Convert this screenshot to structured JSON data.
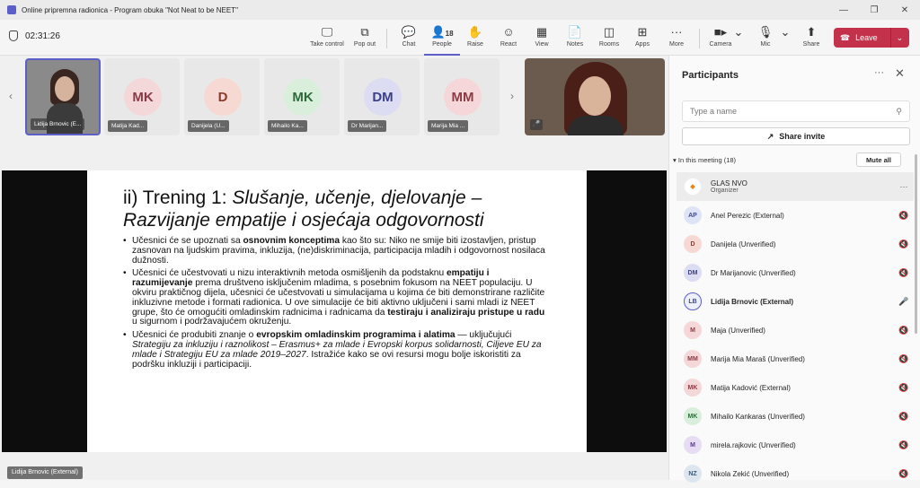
{
  "window": {
    "title": "Online pripremna radionica - Program obuka \"Not Neat to be NEET\"",
    "minimize": "—",
    "restore": "❐",
    "close": "✕"
  },
  "toolbar": {
    "timer": "02:31:26",
    "take_control": "Take control",
    "pop_out": "Pop out",
    "chat": "Chat",
    "people": "People",
    "people_count": "18",
    "raise": "Raise",
    "react": "React",
    "view": "View",
    "notes": "Notes",
    "rooms": "Rooms",
    "apps": "Apps",
    "more": "More",
    "camera": "Camera",
    "mic": "Mic",
    "share": "Share",
    "leave": "Leave"
  },
  "gallery": {
    "tiles": [
      {
        "initials": "",
        "name": "Lidija Brnovic (E..."
      },
      {
        "initials": "MK",
        "name": "Matija Kad...",
        "bg": "#f4d7d9",
        "fg": "#8a3b44"
      },
      {
        "initials": "D",
        "name": "Danijela (U...",
        "bg": "#f6d9d3",
        "fg": "#8a3b2f"
      },
      {
        "initials": "MK",
        "name": "Mihailo Ka...",
        "bg": "#d9efdc",
        "fg": "#2e6b39"
      },
      {
        "initials": "DM",
        "name": "Dr Marijan...",
        "bg": "#dcdcf3",
        "fg": "#3b3f8a"
      },
      {
        "initials": "MM",
        "name": "Marija Mia ...",
        "bg": "#f6d7d9",
        "fg": "#8a3b44"
      }
    ]
  },
  "slide": {
    "title_plain": "ii) Trening 1: ",
    "title_italic1": "Slušanje, učenje, djelovanje –",
    "title_italic2": "Razvijanje empatije i osjećaja odgovornosti",
    "b1_a": "Učesnici će se upoznati sa ",
    "b1_b": "osnovnim konceptima",
    "b1_c": " kao što su: Niko ne smije biti izostavljen, pristup zasnovan na ljudskim pravima, inkluzija, (ne)diskriminacija, participacija mladih i odgovornost nosilaca dužnosti.",
    "b2_a": "Učesnici će učestvovati u nizu interaktivnih metoda osmišljenih da podstaknu ",
    "b2_b": "empatiju i razumijevanje",
    "b2_c": "  prema društveno isključenim mladima, s posebnim fokusom na NEET populaciju. U okviru praktičnog dijela, učesnici će učestvovati u simulacijama u kojima će biti demonstrirane različite inkluzivne metode i formati radionica. U ove simulacije će biti aktivno uključeni i sami mladi iz NEET grupe, što će omogućiti omladinskim radnicima i radnicama da ",
    "b2_d": "testiraju i analiziraju pristupe u radu",
    "b2_e": "  u sigurnom i podržavajućem okruženju.",
    "b3_a": "Učesnici će produbiti znanje o ",
    "b3_b": "evropskim omladinskim programima i alatima",
    "b3_c": " — uključujući ",
    "b3_d": "Strategiju za inkluziju i raznolikost – Erasmus+ za mlade i Evropski korpus solidarnosti, Ciljeve EU za mlade i Strategiju EU za mlade 2019–2027",
    "b3_e": ". Istražiće kako se ovi resursi mogu bolje iskoristiti za podršku inkluziji i participaciji."
  },
  "sharer": "Lidija Brnovic (External)",
  "panel": {
    "title": "Participants",
    "search_placeholder": "Type a name",
    "share_invite": "Share invite",
    "in_meeting": "In this meeting (18)",
    "mute_all": "Mute all",
    "people": [
      {
        "initials": "◆",
        "name": "GLAS NVO",
        "role": "Organizer",
        "bg": "#ffffff",
        "fg": "#e08a1e",
        "mic": "···",
        "speaking": false
      },
      {
        "initials": "AP",
        "name": "Anel Perezic (External)",
        "bg": "#dfe3f6",
        "fg": "#3b4a8a",
        "mic": "🎙",
        "speaking": false
      },
      {
        "initials": "D",
        "name": "Danijela (Unverified)",
        "bg": "#f6d9d3",
        "fg": "#8a3b2f",
        "mic": "🎙",
        "speaking": false
      },
      {
        "initials": "DM",
        "name": "Dr Marijanovic (Unverified)",
        "bg": "#dcdcf3",
        "fg": "#3b3f8a",
        "mic": "🎙",
        "speaking": false
      },
      {
        "initials": "LB",
        "name": "Lidija Brnovic (External)",
        "bg": "#eef0fb",
        "fg": "#3b4a8a",
        "mic": "🎤",
        "speaking": true
      },
      {
        "initials": "M",
        "name": "Maja (Unverified)",
        "bg": "#f6d7d9",
        "fg": "#8a3b44",
        "mic": "🎙",
        "speaking": false
      },
      {
        "initials": "MM",
        "name": "Marija Mia Maraš (Unverified)",
        "bg": "#f6d7d9",
        "fg": "#8a3b44",
        "mic": "🎙",
        "speaking": false
      },
      {
        "initials": "MK",
        "name": "Matija Kadović (External)",
        "bg": "#f4d7d9",
        "fg": "#8a3b44",
        "mic": "🎙",
        "speaking": false
      },
      {
        "initials": "MK",
        "name": "Mihailo Kankaras (Unverified)",
        "bg": "#d9efdc",
        "fg": "#2e6b39",
        "mic": "🎙",
        "speaking": false
      },
      {
        "initials": "M",
        "name": "mirela.rajkovic (Unverified)",
        "bg": "#e6dcf3",
        "fg": "#5b3b8a",
        "mic": "🎙",
        "speaking": false
      },
      {
        "initials": "NZ",
        "name": "Nikola Zekić (Unverified)",
        "bg": "#dde6ef",
        "fg": "#3b5a7a",
        "mic": "🎙",
        "speaking": false
      }
    ]
  }
}
